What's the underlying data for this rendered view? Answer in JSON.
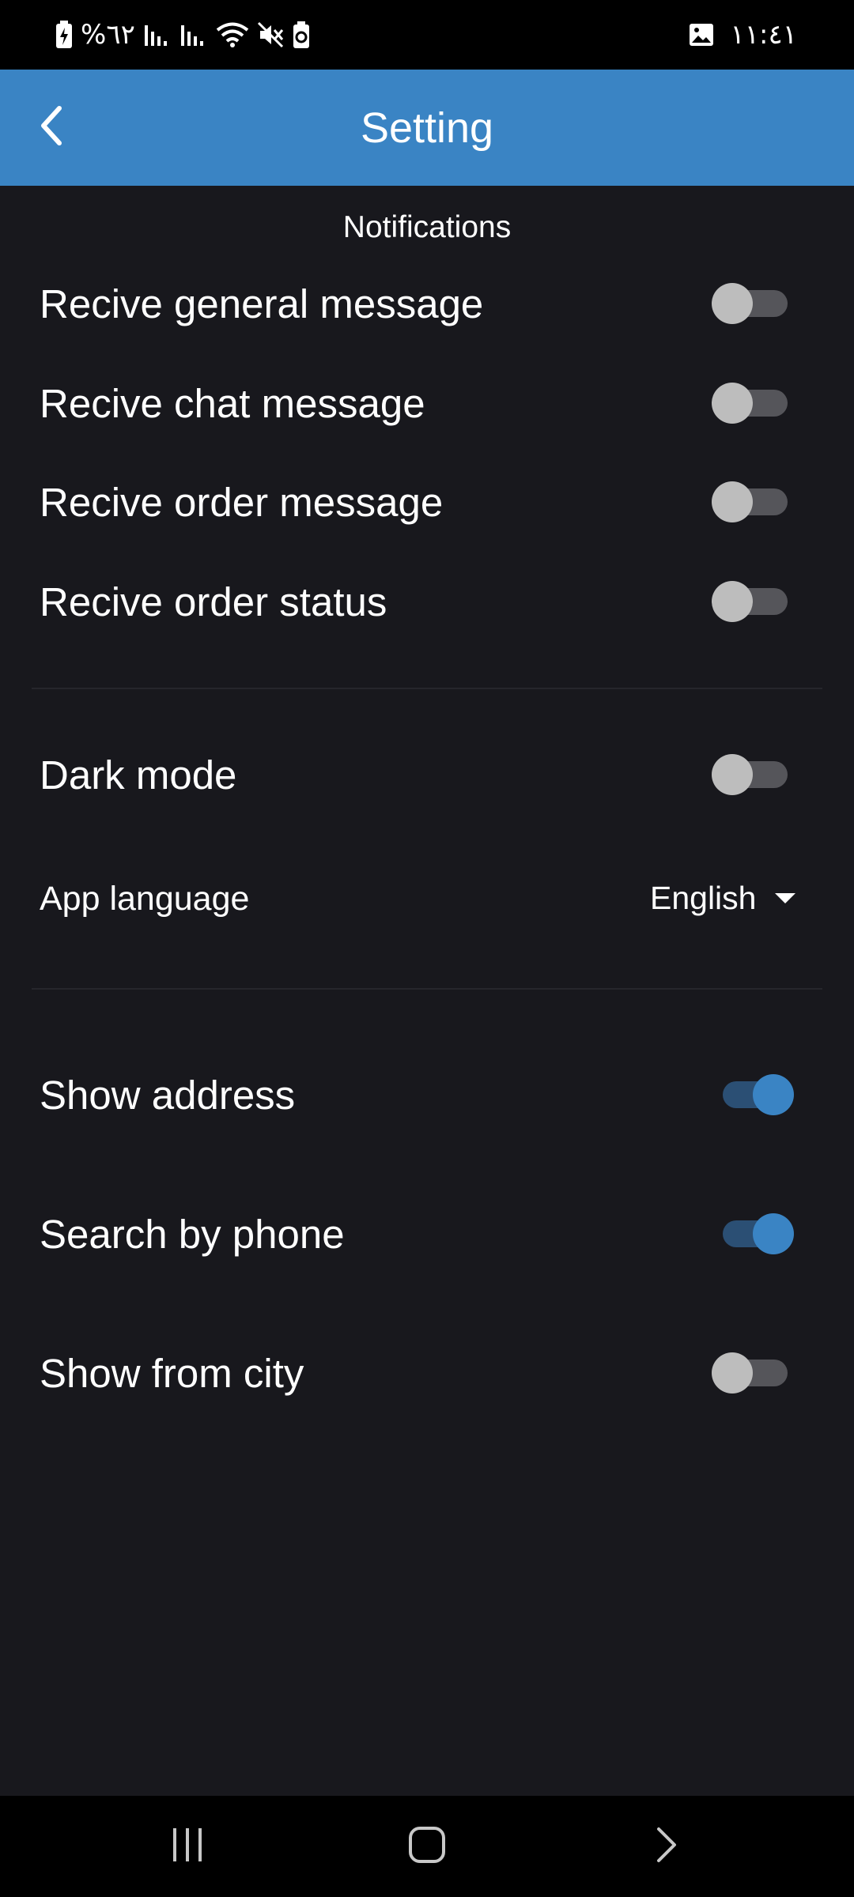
{
  "status_bar": {
    "battery_text": "%٦٢",
    "time": "١١:٤١"
  },
  "app_bar": {
    "title": "Setting",
    "back_icon": "chevron-left-icon"
  },
  "notifications": {
    "header": "Notifications",
    "items": [
      {
        "label": "Recive general message",
        "enabled": false
      },
      {
        "label": "Recive chat message",
        "enabled": false
      },
      {
        "label": "Recive order message",
        "enabled": false
      },
      {
        "label": "Recive order status",
        "enabled": false
      }
    ]
  },
  "appearance": {
    "dark_mode": {
      "label": "Dark mode",
      "enabled": false
    },
    "language": {
      "label": "App language",
      "value": "English"
    }
  },
  "privacy": {
    "items": [
      {
        "label": "Show address",
        "enabled": true
      },
      {
        "label": "Search by phone",
        "enabled": true
      },
      {
        "label": "Show from city",
        "enabled": false
      }
    ]
  },
  "nav_bar": {
    "icons": [
      "recent-apps-icon",
      "home-icon",
      "back-arrow-icon"
    ]
  },
  "colors": {
    "app_bar": "#3a84c4",
    "background": "#18181d",
    "toggle_on": "#3a84c4"
  }
}
